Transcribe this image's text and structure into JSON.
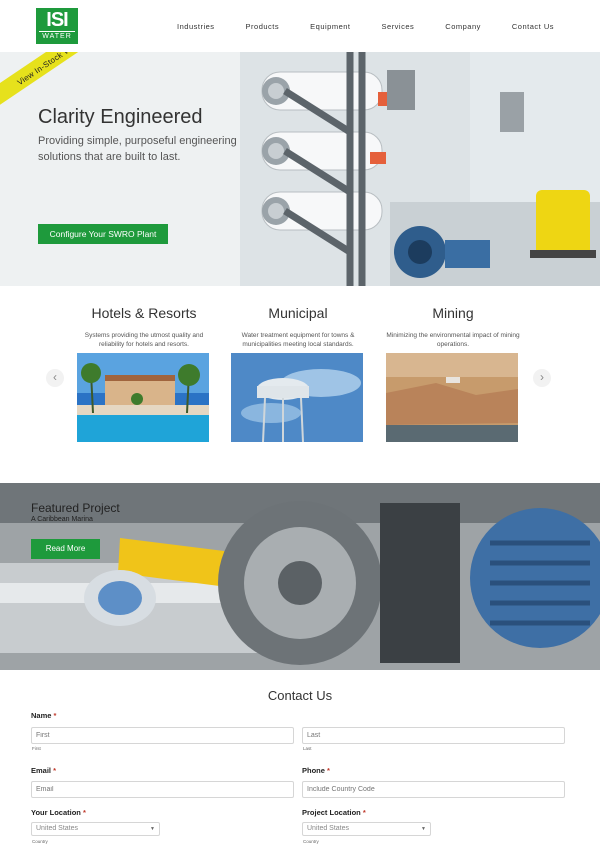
{
  "logo": {
    "line1": "ISI",
    "line2": "WATER"
  },
  "nav": [
    "Industries",
    "Products",
    "Equipment",
    "Services",
    "Company",
    "Contact Us"
  ],
  "hero": {
    "ribbon": "View In-Stock Water Plants ❯",
    "title": "Clarity Engineered",
    "subtitle": "Providing simple, purposeful engineering solutions that are built to last.",
    "button": "Configure Your SWRO Plant"
  },
  "industries": {
    "prev_icon": "‹",
    "next_icon": "›",
    "cards": [
      {
        "title": "Hotels & Resorts",
        "text": "Systems providing the utmost quality and reliability for hotels and resorts."
      },
      {
        "title": "Municipal",
        "text": "Water treatment equipment for towns & municipalities meeting local standards."
      },
      {
        "title": "Mining",
        "text": "Minimizing the environmental impact of mining operations."
      }
    ]
  },
  "featured": {
    "title": "Featured Project",
    "subtitle": "A Caribbean Marina",
    "button": "Read More"
  },
  "contact": {
    "title": "Contact Us",
    "required_mark": "*",
    "name_label": "Name",
    "first_placeholder": "First",
    "first_sub": "First",
    "last_placeholder": "Last",
    "last_sub": "Last",
    "email_label": "Email",
    "email_placeholder": "Email",
    "phone_label": "Phone",
    "phone_placeholder": "Include Country Code",
    "location_label": "Your Location",
    "location_value": "United States",
    "location_sub": "Country",
    "project_label": "Project Location",
    "project_value": "United States",
    "project_sub": "Country"
  },
  "colors": {
    "brand_green": "#1e9a3c",
    "ribbon_yellow": "#e6e11c"
  },
  "icons": {
    "prev": "chevron-left-icon",
    "next": "chevron-right-icon",
    "select": "caret-down-icon"
  }
}
